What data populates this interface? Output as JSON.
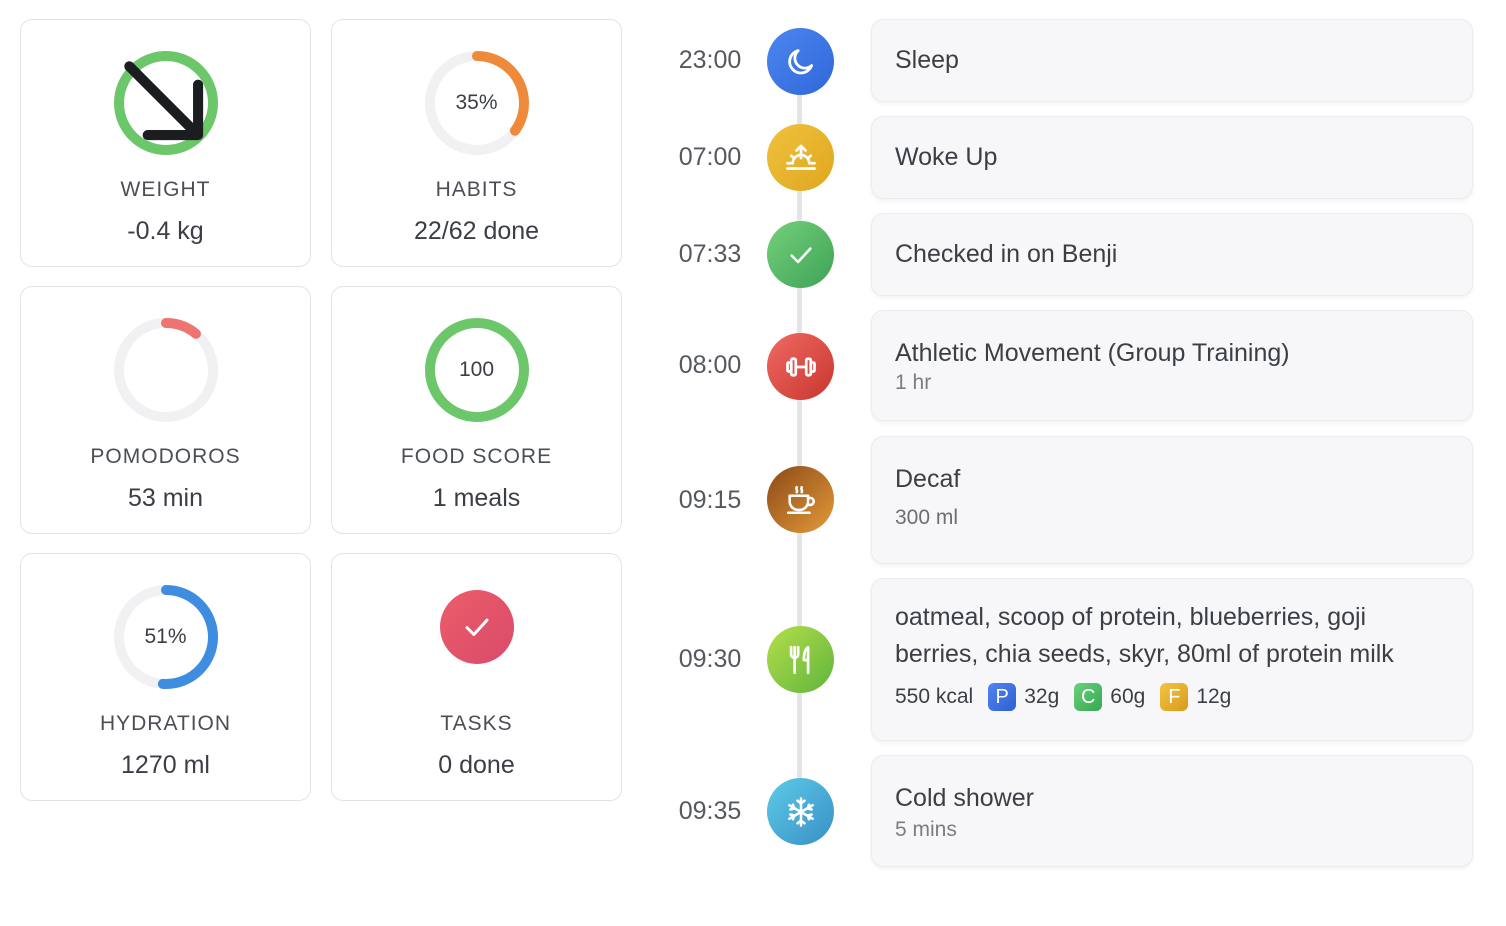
{
  "stats": [
    {
      "label": "WEIGHT",
      "value": "-0.4 kg",
      "center_text": "",
      "icon": "arrow-down-right-icon",
      "progress": 1.0,
      "color": "#6cc76a"
    },
    {
      "label": "HABITS",
      "value": "22/62 done",
      "center_text": "35%",
      "progress": 0.35,
      "color": "#ef8a3a"
    },
    {
      "label": "POMODOROS",
      "value": "53 min",
      "center_text": "",
      "progress": 0.11,
      "color": "#ee7472"
    },
    {
      "label": "FOOD SCORE",
      "value": "1 meals",
      "center_text": "100",
      "progress": 1.0,
      "color": "#6cc76a"
    },
    {
      "label": "HYDRATION",
      "value": "1270 ml",
      "center_text": "51%",
      "progress": 0.51,
      "color": "#3e8de0"
    },
    {
      "label": "TASKS",
      "value": "0 done",
      "center_text": "",
      "icon": "checkmark-icon",
      "color": "#e3566a"
    }
  ],
  "timeline": [
    {
      "time": "23:00",
      "title": "Sleep",
      "icon": "moon-icon",
      "gradient": [
        "#4d86ef",
        "#2f67da"
      ]
    },
    {
      "time": "07:00",
      "title": "Woke Up",
      "icon": "sunrise-icon",
      "gradient": [
        "#f0c23d",
        "#dfa61f"
      ]
    },
    {
      "time": "07:33",
      "title": "Checked in on Benji",
      "icon": "checkmark-icon",
      "gradient": [
        "#74d07a",
        "#3ea257"
      ]
    },
    {
      "time": "08:00",
      "title": "Athletic Movement (Group Training)",
      "subtitle": "1 hr",
      "icon": "dumbbell-icon",
      "gradient": [
        "#ee6a63",
        "#c9362e"
      ]
    },
    {
      "time": "09:15",
      "title": "Decaf",
      "subtitle": "300 ml",
      "icon": "coffee-cup-icon",
      "gradient": [
        "#8a4a17",
        "#e59a3a"
      ]
    },
    {
      "time": "09:30",
      "title": "oatmeal, scoop of protein, blueberries, goji berries, chia seeds, skyr, 80ml of protein milk",
      "icon": "fork-knife-icon",
      "gradient": [
        "#b5de4a",
        "#5fb53d"
      ],
      "calories": "550 kcal",
      "macros": [
        {
          "letter": "P",
          "amount": "32g",
          "color": "#3d74e6"
        },
        {
          "letter": "C",
          "amount": "60g",
          "color": "#4fbf62"
        },
        {
          "letter": "F",
          "amount": "12g",
          "color": "#e7b22b"
        }
      ]
    },
    {
      "time": "09:35",
      "title": "Cold shower",
      "subtitle": "5 mins",
      "icon": "snowflake-icon",
      "gradient": [
        "#5ccbe8",
        "#3a8fc4"
      ]
    }
  ]
}
